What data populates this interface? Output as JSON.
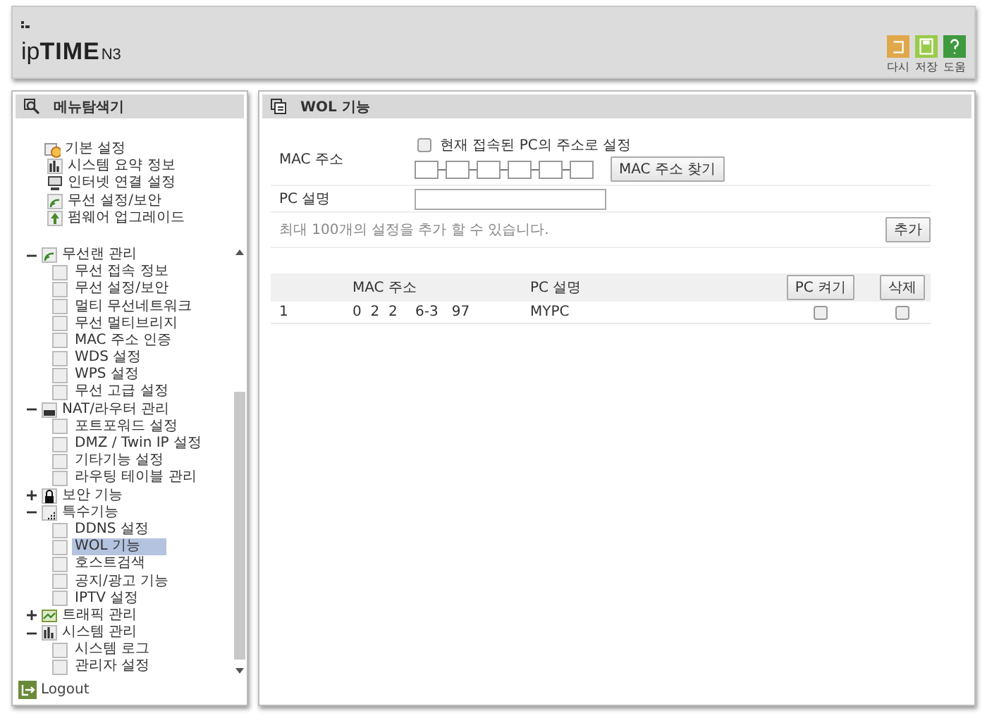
{
  "header": {
    "logo": "ip**TIME**",
    "model": "N3",
    "actions": [
      {
        "label": "다시",
        "kind": "reload"
      },
      {
        "label": "저장",
        "kind": "save"
      },
      {
        "label": "도움",
        "kind": "help"
      }
    ]
  },
  "sidebar": {
    "title": "메뉴탐색기",
    "fixed": [
      {
        "label": "기본 설정",
        "kind": "folder",
        "children": [
          {
            "label": "시스템 요약 정보",
            "kind": "chart"
          },
          {
            "label": "인터넷 연결 설정",
            "kind": "monitor"
          },
          {
            "label": "무선 설정/보안",
            "kind": "wireless"
          },
          {
            "label": "펌웨어 업그레이드",
            "kind": "upgrade"
          }
        ]
      }
    ],
    "tree": [
      {
        "label": "무선랜 관리",
        "kind": "wireless",
        "expanded": true,
        "children": [
          {
            "label": "무선 접속 정보",
            "selected": false
          },
          {
            "label": "무선 설정/보안",
            "selected": false
          },
          {
            "label": "멀티 무선네트워크",
            "selected": false
          },
          {
            "label": "무선 멀티브리지",
            "selected": false
          },
          {
            "label": "MAC 주소 인증",
            "selected": false
          },
          {
            "label": "WDS 설정",
            "selected": false
          },
          {
            "label": "WPS 설정",
            "selected": false
          },
          {
            "label": "무선 고급 설정",
            "selected": false
          }
        ]
      },
      {
        "label": "NAT/라우터 관리",
        "kind": "router",
        "expanded": true,
        "children": [
          {
            "label": "포트포워드 설정",
            "selected": false
          },
          {
            "label": "DMZ / Twin IP 설정",
            "selected": false
          },
          {
            "label": "기타기능 설정",
            "selected": false
          },
          {
            "label": "라우팅 테이블 관리",
            "selected": false
          }
        ]
      },
      {
        "label": "보안 기능",
        "kind": "lock",
        "expanded": false
      },
      {
        "label": "특수기능",
        "kind": "tools",
        "expanded": true,
        "children": [
          {
            "label": "DDNS 설정",
            "selected": false
          },
          {
            "label": "WOL 기능",
            "selected": true
          },
          {
            "label": "호스트검색",
            "selected": false
          },
          {
            "label": "공지/광고 기능",
            "selected": false
          },
          {
            "label": "IPTV 설정",
            "selected": false
          }
        ]
      },
      {
        "label": "트래픽 관리",
        "kind": "traffic",
        "expanded": false
      },
      {
        "label": "시스템 관리",
        "kind": "chart",
        "expanded": true,
        "children": [
          {
            "label": "시스템 로그",
            "selected": false
          },
          {
            "label": "관리자 설정",
            "selected": false
          }
        ]
      }
    ],
    "logout": "Logout"
  },
  "panel": {
    "title": "WOL 기능",
    "form": {
      "mac_label": "MAC 주소",
      "use_current": {
        "label": "현재 접속된 PC의 주소로 설정",
        "checked": false
      },
      "find_button": "MAC 주소 찾기",
      "desc_label": "PC 설명",
      "note": "최대 100개의 설정을 추가 할 수 있습니다.",
      "add_button": "추가"
    },
    "table": {
      "columns": [
        "MAC 주소",
        "PC 설명"
      ],
      "wake_button": "PC 켜기",
      "delete_button": "삭제",
      "rows": [
        {
          "index": "1",
          "mac": "0  2  2    6-3   97",
          "description": "MYPC",
          "wake": false,
          "delete": false
        }
      ]
    }
  }
}
